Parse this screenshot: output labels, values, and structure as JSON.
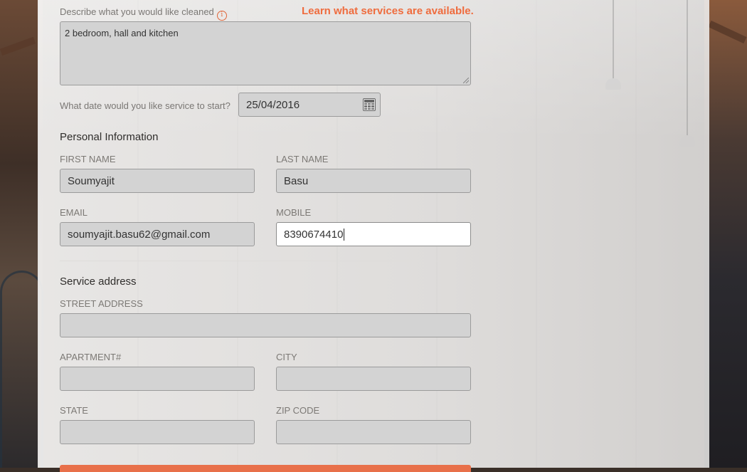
{
  "colors": {
    "accent": "#ef6c3e",
    "field_bg": "#d3d3d3",
    "field_active_bg": "#ffffff"
  },
  "service": {
    "describe_label": "Describe what you would like cleaned",
    "learn_link": "Learn what services are available.",
    "description_value": "2 bedroom, hall and kitchen",
    "date_label": "What date would you like service to start?",
    "date_value": "25/04/2016"
  },
  "personal": {
    "title": "Personal Information",
    "first_name_label": "FIRST NAME",
    "first_name_value": "Soumyajit",
    "last_name_label": "LAST NAME",
    "last_name_value": "Basu",
    "email_label": "EMAIL",
    "email_value": "soumyajit.basu62@gmail.com",
    "mobile_label": "MOBILE",
    "mobile_value": "8390674410"
  },
  "address": {
    "title": "Service address",
    "street_label": "STREET ADDRESS",
    "street_value": "",
    "apartment_label": "APARTMENT#",
    "apartment_value": "",
    "city_label": "CITY",
    "city_value": "",
    "state_label": "STATE",
    "state_value": "",
    "zip_label": "ZIP CODE",
    "zip_value": ""
  }
}
